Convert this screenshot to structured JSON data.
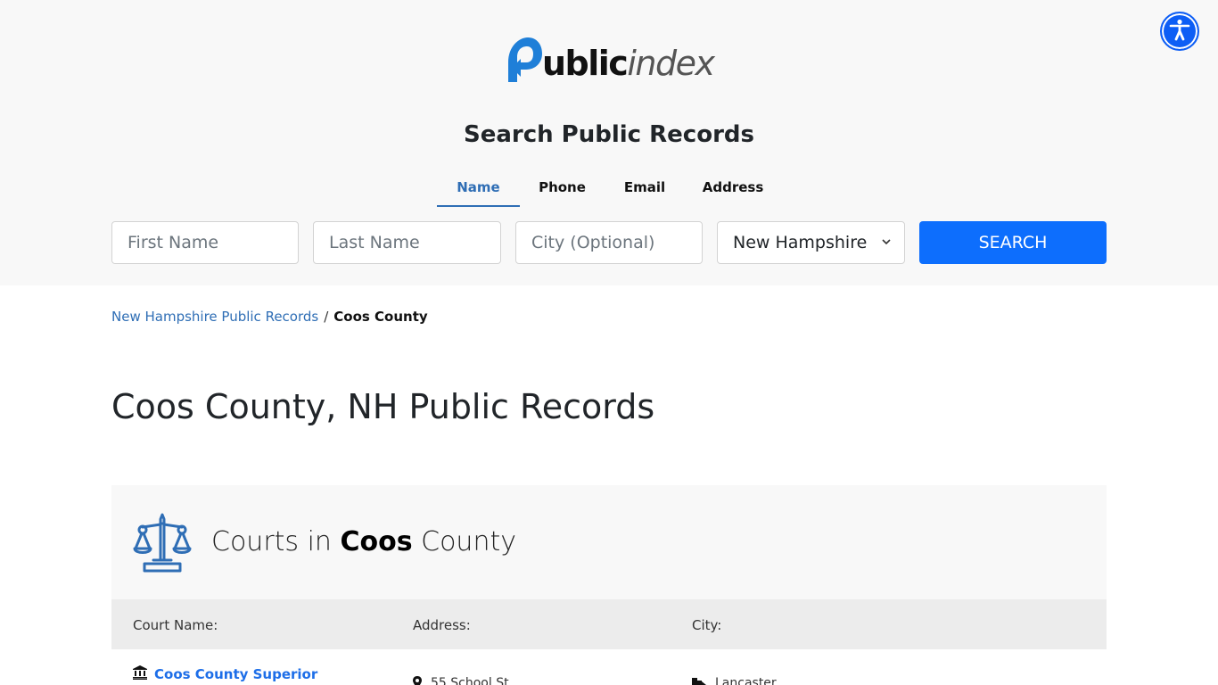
{
  "brand": {
    "logo_bold": "ublic",
    "logo_light": "index",
    "accent_color": "#1f7fd8"
  },
  "accessibility": {
    "icon": "accessibility-person-icon",
    "color": "#0d5ef5"
  },
  "search": {
    "title": "Search Public Records",
    "tabs": [
      {
        "label": "Name",
        "active": true
      },
      {
        "label": "Phone",
        "active": false
      },
      {
        "label": "Email",
        "active": false
      },
      {
        "label": "Address",
        "active": false
      }
    ],
    "first_name_placeholder": "First Name",
    "last_name_placeholder": "Last Name",
    "city_placeholder": "City (Optional)",
    "state_selected": "New Hampshire",
    "button_label": "SEARCH",
    "button_color": "#0d6efd"
  },
  "breadcrumb": {
    "parent": "New Hampshire Public Records",
    "separator": "/",
    "current": "Coos County"
  },
  "page": {
    "title": "Coos County, NH Public Records"
  },
  "courts": {
    "heading_prefix": "Courts in",
    "heading_bold": "Coos",
    "heading_suffix": "County",
    "icon": "scales-of-justice-icon",
    "columns": [
      "Court Name:",
      "Address:",
      "City:"
    ],
    "rows": [
      {
        "name": "Coos County Superior",
        "address": "55 School St",
        "city": "Lancaster"
      }
    ]
  }
}
